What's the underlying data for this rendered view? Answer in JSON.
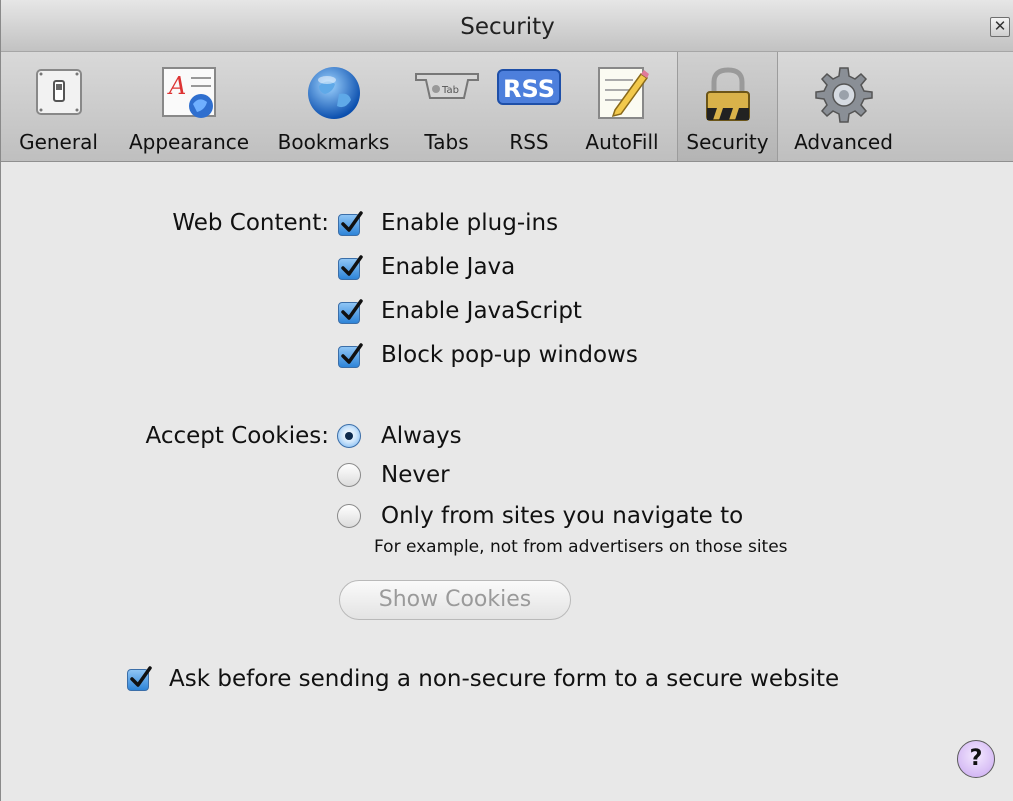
{
  "window": {
    "title": "Security"
  },
  "toolbar": {
    "items": [
      {
        "label": "General",
        "icon": "general-switch-icon"
      },
      {
        "label": "Appearance",
        "icon": "appearance-icon"
      },
      {
        "label": "Bookmarks",
        "icon": "globe-icon"
      },
      {
        "label": "Tabs",
        "icon": "tab-icon",
        "icon_text": "Tab"
      },
      {
        "label": "RSS",
        "icon": "rss-icon",
        "icon_text": "RSS"
      },
      {
        "label": "AutoFill",
        "icon": "pencil-form-icon"
      },
      {
        "label": "Security",
        "icon": "lock-icon",
        "selected": true
      },
      {
        "label": "Advanced",
        "icon": "gear-icon"
      }
    ]
  },
  "web_content": {
    "label": "Web Content:",
    "options": [
      {
        "label": "Enable plug-ins",
        "checked": true
      },
      {
        "label": "Enable Java",
        "checked": true
      },
      {
        "label": "Enable JavaScript",
        "checked": true
      },
      {
        "label": "Block pop-up windows",
        "checked": true
      }
    ]
  },
  "cookies": {
    "label": "Accept Cookies:",
    "options": [
      {
        "label": "Always",
        "selected": true
      },
      {
        "label": "Never",
        "selected": false
      },
      {
        "label": "Only from sites you navigate to",
        "selected": false
      }
    ],
    "hint": "For example, not from advertisers on those sites",
    "show_button": "Show Cookies"
  },
  "form_warning": {
    "label": "Ask before sending a non-secure form to a secure website",
    "checked": true
  },
  "help_label": "?",
  "colors": {
    "checkbox_blue": "#2e84d8",
    "help_purple": "#c9a8f0"
  }
}
